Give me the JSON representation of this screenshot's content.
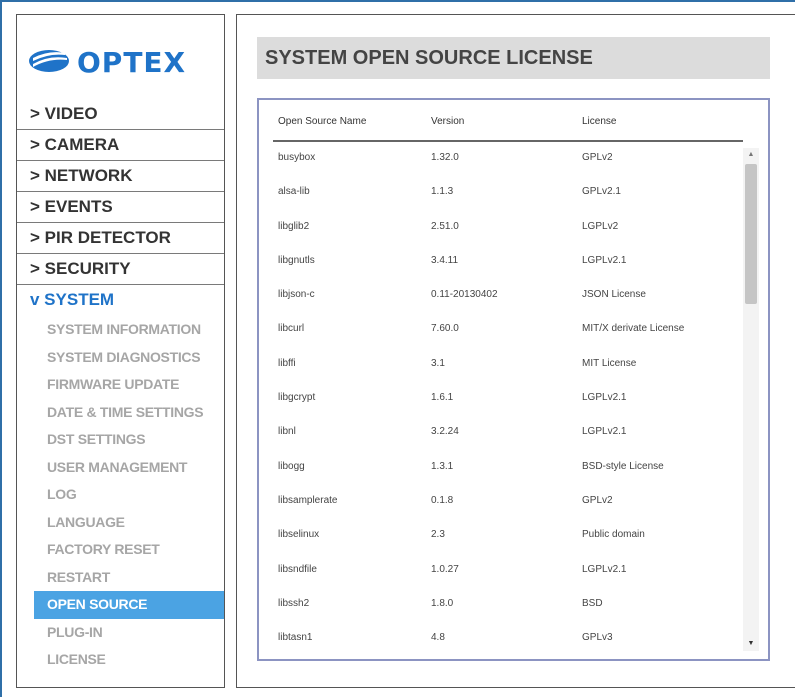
{
  "brand": {
    "name": "OPTEX",
    "color": "#1f73c8"
  },
  "menu": [
    {
      "label": "> VIDEO",
      "name": "menu-video"
    },
    {
      "label": "> CAMERA",
      "name": "menu-camera"
    },
    {
      "label": "> NETWORK",
      "name": "menu-network"
    },
    {
      "label": "> EVENTS",
      "name": "menu-events"
    },
    {
      "label": "> PIR DETECTOR",
      "name": "menu-pir-detector"
    },
    {
      "label": "> SECURITY",
      "name": "menu-security"
    },
    {
      "label": "v SYSTEM",
      "name": "menu-system"
    }
  ],
  "submenu": [
    "SYSTEM INFORMATION",
    "SYSTEM DIAGNOSTICS",
    "FIRMWARE UPDATE",
    "DATE & TIME SETTINGS",
    "DST SETTINGS",
    "USER MANAGEMENT",
    "LOG",
    "LANGUAGE",
    "FACTORY RESET",
    "RESTART",
    "OPEN SOURCE",
    "PLUG-IN",
    "LICENSE"
  ],
  "active_submenu": "OPEN SOURCE",
  "page": {
    "title": "SYSTEM OPEN SOURCE LICENSE"
  },
  "table": {
    "headers": [
      "Open Source Name",
      "Version",
      "License"
    ],
    "rows": [
      [
        "busybox",
        "1.32.0",
        "GPLv2"
      ],
      [
        "alsa-lib",
        "1.1.3",
        "GPLv2.1"
      ],
      [
        "libglib2",
        "2.51.0",
        "LGPLv2"
      ],
      [
        "libgnutls",
        "3.4.11",
        "LGPLv2.1"
      ],
      [
        "libjson-c",
        "0.11-20130402",
        "JSON License"
      ],
      [
        "libcurl",
        "7.60.0",
        "MIT/X derivate License"
      ],
      [
        "libffi",
        "3.1",
        "MIT License"
      ],
      [
        "libgcrypt",
        "1.6.1",
        "LGPLv2.1"
      ],
      [
        "libnl",
        "3.2.24",
        "LGPLv2.1"
      ],
      [
        "libogg",
        "1.3.1",
        "BSD-style License"
      ],
      [
        "libsamplerate",
        "0.1.8",
        "GPLv2"
      ],
      [
        "libselinux",
        "2.3",
        "Public domain"
      ],
      [
        "libsndfile",
        "1.0.27",
        "LGPLv2.1"
      ],
      [
        "libssh2",
        "1.8.0",
        "BSD"
      ],
      [
        "libtasn1",
        "4.8",
        "GPLv3"
      ]
    ]
  }
}
